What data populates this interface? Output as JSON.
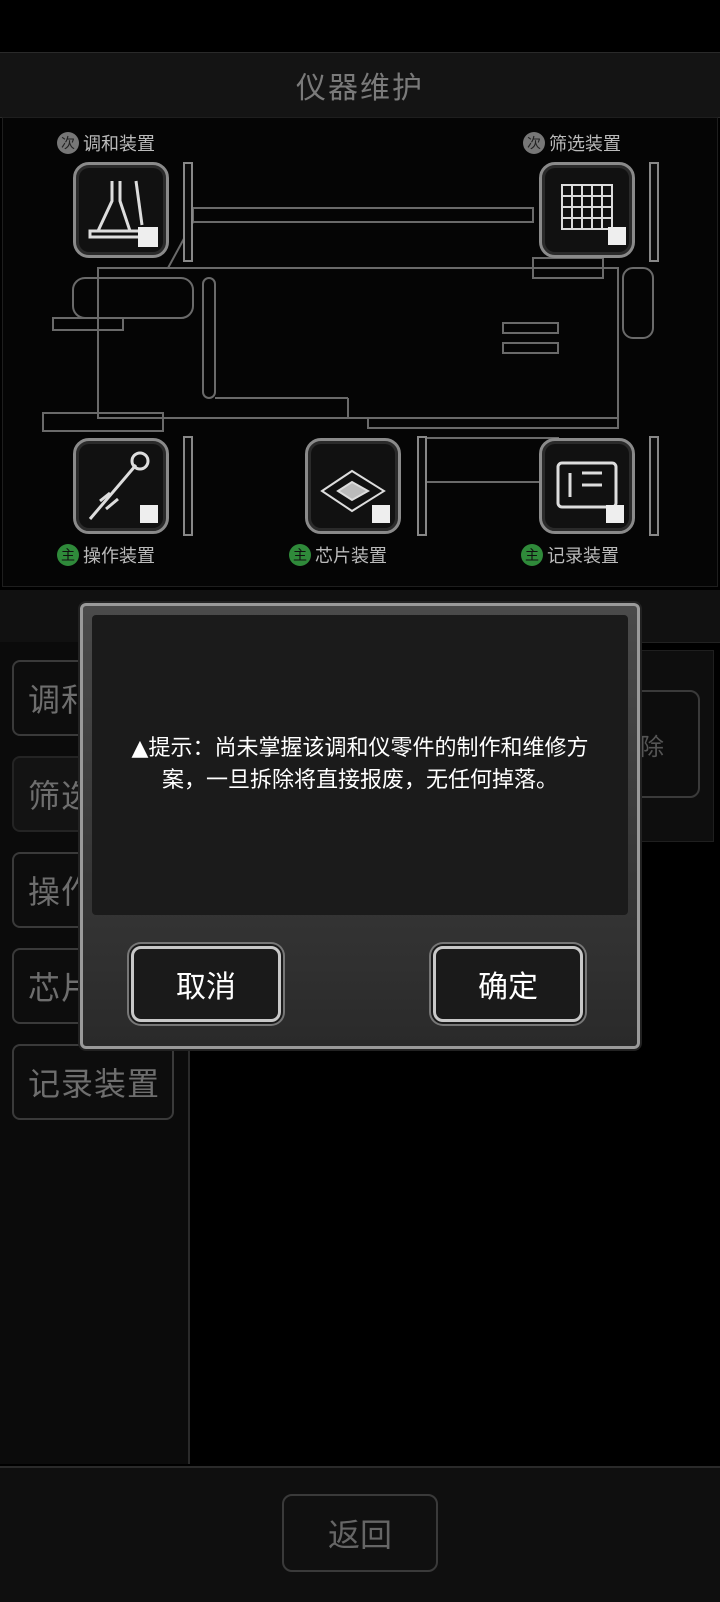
{
  "header": {
    "title": "仪器维护"
  },
  "schematic": {
    "devices": [
      {
        "label": "调和装置",
        "badge": "次",
        "tier": "secondary",
        "icon": "flask-icon"
      },
      {
        "label": "筛选装置",
        "badge": "次",
        "tier": "secondary",
        "icon": "sieve-icon"
      },
      {
        "label": "操作装置",
        "badge": "主",
        "tier": "main",
        "icon": "probe-icon"
      },
      {
        "label": "芯片装置",
        "badge": "主",
        "tier": "main",
        "icon": "chip-icon"
      },
      {
        "label": "记录装置",
        "badge": "主",
        "tier": "main",
        "icon": "recorder-icon"
      }
    ]
  },
  "sidebar": {
    "items": [
      {
        "label": "调和"
      },
      {
        "label": "筛选"
      },
      {
        "label": "操作"
      },
      {
        "label": "芯片"
      },
      {
        "label": "记录装置"
      }
    ]
  },
  "right_panel": {
    "remove_label": "除"
  },
  "footer": {
    "back_label": "返回"
  },
  "dialog": {
    "message": "▲提示：尚未掌握该调和仪零件的制作和维修方案，一旦拆除将直接报废，无任何掉落。",
    "cancel_label": "取消",
    "confirm_label": "确定"
  },
  "colors": {
    "main_badge": "#2f8a3a",
    "secondary_badge": "#777777",
    "background": "#000000"
  }
}
